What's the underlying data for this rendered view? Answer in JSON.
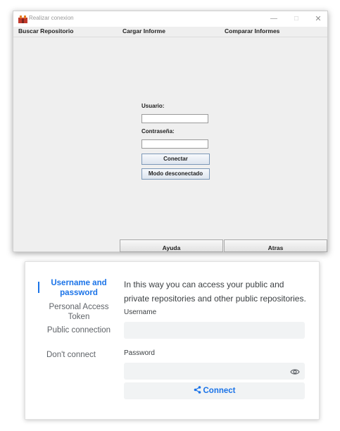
{
  "window": {
    "title": "Realizar conexion",
    "controls": {
      "minimize": "—",
      "maximize": "☐",
      "close": "✕"
    },
    "menu": [
      "Buscar Repositorio",
      "Cargar Informe",
      "Comparar Informes"
    ],
    "form": {
      "user_label": "Usuario:",
      "user_value": "",
      "password_label": "Contraseña:",
      "password_value": "",
      "connect_button": "Conectar",
      "offline_button": "Modo desconectado"
    },
    "bottom_buttons": [
      "Ayuda",
      "Atras"
    ]
  },
  "login_card": {
    "nav": [
      "Username and password",
      "Personal Access Token",
      "Public connection",
      "Don't connect"
    ],
    "active_nav": 0,
    "description": "In this way you can access your public and private repositories and other public repositories.",
    "username_label": "Username",
    "username_value": "",
    "password_label": "Password",
    "password_value": "",
    "connect_button": "Connect",
    "accent_color": "#1a73e8"
  }
}
